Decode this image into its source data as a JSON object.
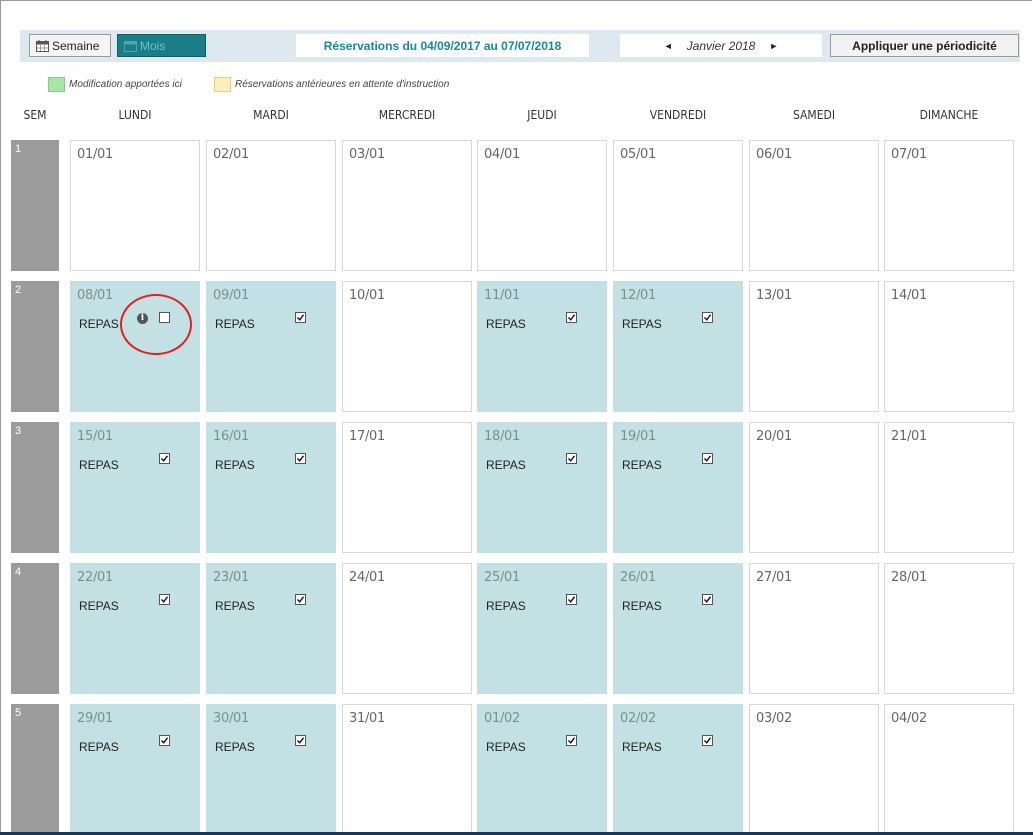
{
  "toolbar": {
    "week_label": "Semaine",
    "month_label": "Mois",
    "range_label": "Réservations du 04/09/2017 au 07/07/2018",
    "month_nav": {
      "prev_symbol": "◄",
      "label": "Janvier 2018",
      "next_symbol": "►"
    },
    "apply_label": "Appliquer une périodicité"
  },
  "legend": {
    "modified": "Modification apportées ici",
    "pending": "Réservations antérieures en attente d'instruction",
    "colors": {
      "modified": "#a8e6a3",
      "pending": "#fdf0b9"
    }
  },
  "headers": [
    "SEM",
    "LUNDI",
    "MARDI",
    "MERCREDI",
    "JEUDI",
    "VENDREDI",
    "SAMEDI",
    "DIMANCHE"
  ],
  "colors": {
    "booked": "#c3e1e4",
    "week_bar": "#9b9b9b",
    "active_button": "#1b7d86",
    "accent_text": "#178a95",
    "highlight_circle": "#e21e1e"
  },
  "weeks": [
    {
      "num": "1",
      "days": [
        {
          "date": "01/01"
        },
        {
          "date": "02/01"
        },
        {
          "date": "03/01"
        },
        {
          "date": "04/01"
        },
        {
          "date": "05/01"
        },
        {
          "date": "06/01"
        },
        {
          "date": "07/01"
        }
      ]
    },
    {
      "num": "2",
      "days": [
        {
          "date": "08/01",
          "repas": "REPAS",
          "checked": false,
          "info": true
        },
        {
          "date": "09/01",
          "repas": "REPAS",
          "checked": true
        },
        {
          "date": "10/01"
        },
        {
          "date": "11/01",
          "repas": "REPAS",
          "checked": true
        },
        {
          "date": "12/01",
          "repas": "REPAS",
          "checked": true
        },
        {
          "date": "13/01"
        },
        {
          "date": "14/01"
        }
      ]
    },
    {
      "num": "3",
      "days": [
        {
          "date": "15/01",
          "repas": "REPAS",
          "checked": true
        },
        {
          "date": "16/01",
          "repas": "REPAS",
          "checked": true
        },
        {
          "date": "17/01"
        },
        {
          "date": "18/01",
          "repas": "REPAS",
          "checked": true
        },
        {
          "date": "19/01",
          "repas": "REPAS",
          "checked": true
        },
        {
          "date": "20/01"
        },
        {
          "date": "21/01"
        }
      ]
    },
    {
      "num": "4",
      "days": [
        {
          "date": "22/01",
          "repas": "REPAS",
          "checked": true
        },
        {
          "date": "23/01",
          "repas": "REPAS",
          "checked": true
        },
        {
          "date": "24/01"
        },
        {
          "date": "25/01",
          "repas": "REPAS",
          "checked": true
        },
        {
          "date": "26/01",
          "repas": "REPAS",
          "checked": true
        },
        {
          "date": "27/01"
        },
        {
          "date": "28/01"
        }
      ]
    },
    {
      "num": "5",
      "days": [
        {
          "date": "29/01",
          "repas": "REPAS",
          "checked": true
        },
        {
          "date": "30/01",
          "repas": "REPAS",
          "checked": true
        },
        {
          "date": "31/01"
        },
        {
          "date": "01/02",
          "repas": "REPAS",
          "checked": true
        },
        {
          "date": "02/02",
          "repas": "REPAS",
          "checked": true
        },
        {
          "date": "03/02"
        },
        {
          "date": "04/02"
        }
      ]
    }
  ]
}
